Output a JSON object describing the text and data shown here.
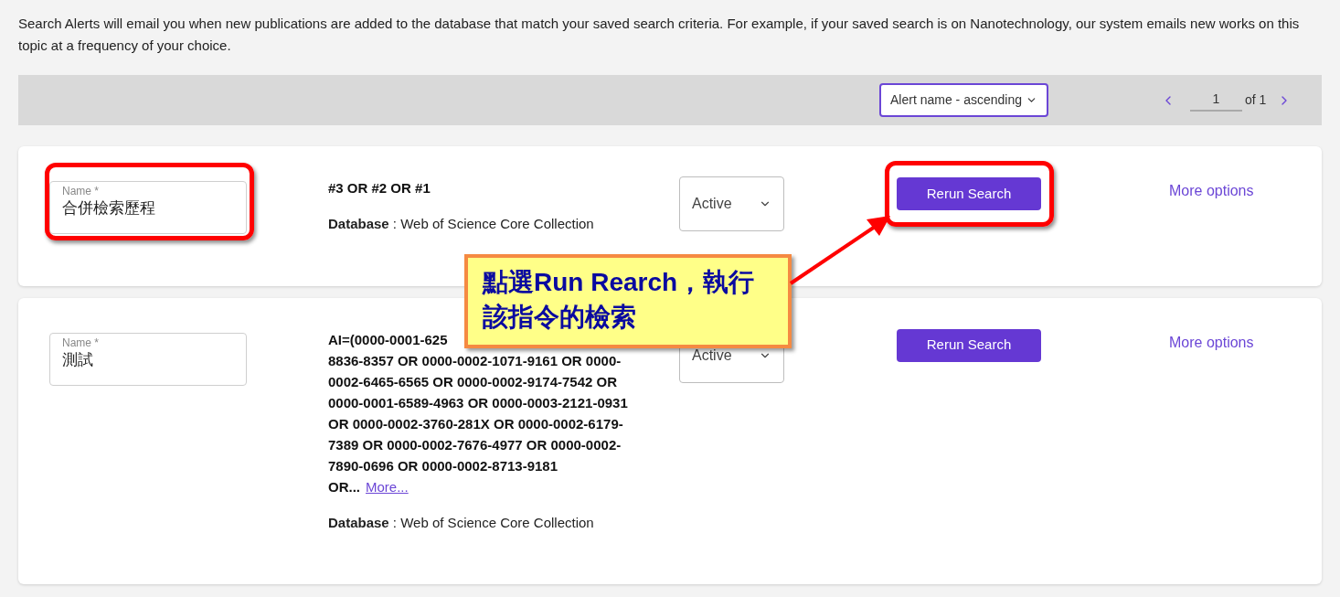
{
  "intro": "Search Alerts will email you when new publications are added to the database that match your saved search criteria. For example, if your saved search is on Nanotechnology, our system emails new works on this topic at a frequency of your choice.",
  "sort": {
    "value": "Alert name - ascending"
  },
  "pagination": {
    "page": "1",
    "of_label": "of 1"
  },
  "alerts": [
    {
      "highlighted": true,
      "name_label": "Name *",
      "name": "合併檢索歷程",
      "query_start": "#3 OR #2 OR #1",
      "database": "**Database** : Web of Science Core Collection",
      "status": "Active",
      "button": "Rerun Search",
      "more_options": "More options"
    },
    {
      "highlighted": false,
      "name_label": "Name *",
      "name": "測試",
      "query_start": "AI=(0000-0001-625",
      "query_rest": "8836-8357 OR 0000-0002-1071-9161 OR 0000-0002-6465-6565 OR 0000-0002-9174-7542 OR 0000-0001-6589-4963 OR 0000-0003-2121-0931 OR 0000-0002-3760-281X OR 0000-0002-6179-7389 OR 0000-0002-7676-4977 OR 0000-0002-7890-0696 OR 0000-0002-8713-9181 OR...",
      "more_link": "More...",
      "database": "**Database** : Web of Science Core Collection",
      "status": "Active",
      "button": "Rerun Search",
      "more_options": "More options"
    }
  ],
  "callout": {
    "text": "點選Run Rearch，執行該指令的檢索"
  }
}
